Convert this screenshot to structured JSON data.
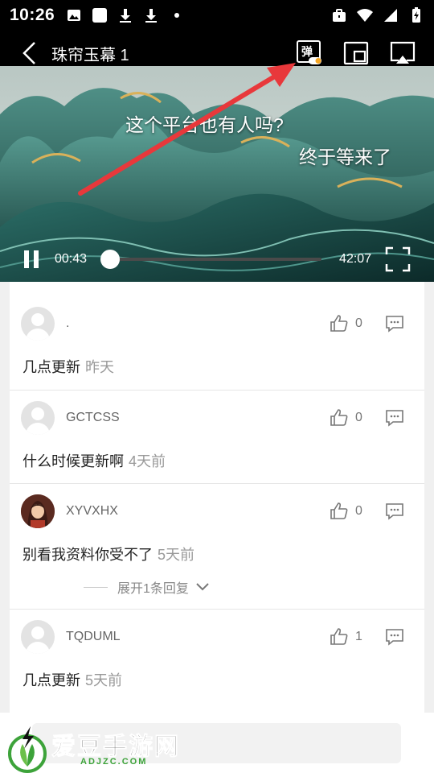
{
  "status_bar": {
    "time": "10:26"
  },
  "video": {
    "title": "珠帘玉幕 1",
    "danmaku_toggle_label": "弹",
    "danmaku": [
      "这个平台也有人吗?",
      "终于等来了"
    ],
    "current_time": "00:43",
    "total_time": "42:07",
    "progress": 0.017
  },
  "comments": [
    {
      "username": ".",
      "likes": "0",
      "text": "几点更新",
      "ago": "昨天"
    },
    {
      "username": "GCTCSS",
      "likes": "0",
      "text": "什么时候更新啊",
      "ago": "4天前"
    },
    {
      "username": "XYVXHX",
      "likes": "0",
      "text": "别看我资料你受不了",
      "ago": "5天前",
      "expand_label": "展开1条回复"
    },
    {
      "username": "TQDUML",
      "likes": "1",
      "text": "几点更新",
      "ago": "5天前"
    }
  ],
  "watermark": {
    "name": "爱豆手游网",
    "domain": "ADJZC.COM"
  },
  "colors": {
    "arrow": "#e8383b",
    "toggle_dot": "#f5a623",
    "brand_green": "#3da33a"
  }
}
